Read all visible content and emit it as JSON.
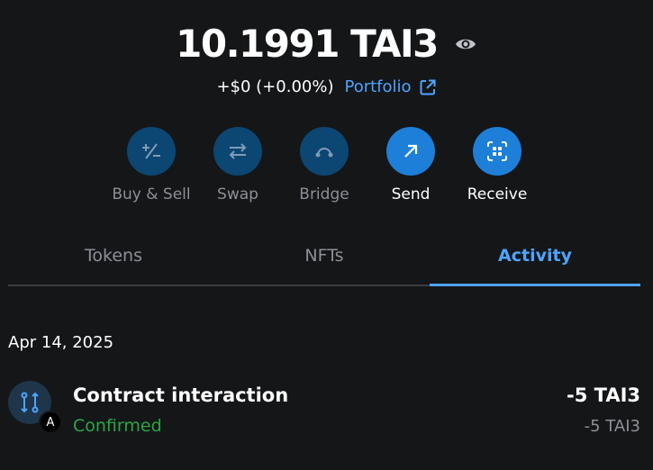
{
  "balance": {
    "amount": "10.1991 TAI3",
    "change": "+$0 (+0.00%)",
    "portfolio_label": "Portfolio"
  },
  "actions": [
    {
      "label": "Buy & Sell",
      "icon": "plus-minus-icon",
      "enabled": false
    },
    {
      "label": "Swap",
      "icon": "swap-arrows-icon",
      "enabled": false
    },
    {
      "label": "Bridge",
      "icon": "bridge-icon",
      "enabled": false
    },
    {
      "label": "Send",
      "icon": "arrow-up-right-icon",
      "enabled": true
    },
    {
      "label": "Receive",
      "icon": "qr-code-icon",
      "enabled": true
    }
  ],
  "tabs": [
    {
      "label": "Tokens",
      "active": false
    },
    {
      "label": "NFTs",
      "active": false
    },
    {
      "label": "Activity",
      "active": true
    }
  ],
  "activity": {
    "date": "Apr 14, 2025",
    "transactions": [
      {
        "title": "Contract interaction",
        "status": "Confirmed",
        "amount": "-5 TAI3",
        "amount_secondary": "-5 TAI3",
        "badge": "A"
      }
    ]
  },
  "colors": {
    "accent": "#4ea4ff",
    "background": "#141618",
    "button_enabled": "#1d7fd8",
    "button_disabled": "#0c4672",
    "status_confirmed": "#28a745",
    "muted_text": "#8c9097"
  }
}
